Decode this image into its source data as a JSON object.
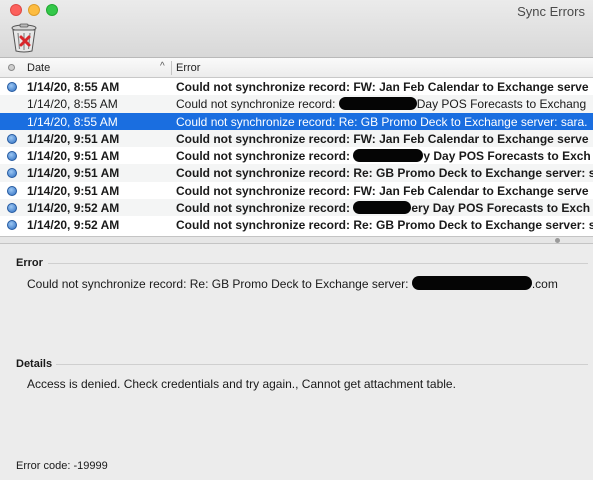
{
  "window": {
    "title": "Sync Errors"
  },
  "toolbar": {
    "trash_icon": "trash-icon"
  },
  "table": {
    "columns": {
      "date": "Date",
      "error": "Error"
    },
    "rows": [
      {
        "date": "1/14/20, 8:55 AM",
        "error": "Could not synchronize record: FW: Jan Feb Calendar  to Exchange serve",
        "bold": true,
        "selected": false,
        "dot": true
      },
      {
        "date": "1/14/20, 8:55 AM",
        "error_pre": "Could not synchronize record: ",
        "error_post": "Day POS Forecasts to Exchang",
        "bold": false,
        "selected": false,
        "dot": false
      },
      {
        "date": "1/14/20, 8:55 AM",
        "error": "Could not synchronize record: Re: GB Promo Deck to Exchange server: sara.",
        "bold": false,
        "selected": true,
        "dot": false
      },
      {
        "date": "1/14/20, 9:51 AM",
        "error": "Could not synchronize record: FW: Jan Feb Calendar  to Exchange serve",
        "bold": true,
        "selected": false,
        "dot": true
      },
      {
        "date": "1/14/20, 9:51 AM",
        "error_pre": "Could not synchronize record: ",
        "error_post": "y Day POS Forecasts to Exch",
        "bold": true,
        "selected": false,
        "dot": true
      },
      {
        "date": "1/14/20, 9:51 AM",
        "error": "Could not synchronize record: Re: GB Promo Deck to Exchange server: s",
        "bold": true,
        "selected": false,
        "dot": true
      },
      {
        "date": "1/14/20, 9:51 AM",
        "error": "Could not synchronize record: FW: Jan Feb Calendar  to Exchange serve",
        "bold": true,
        "selected": false,
        "dot": true
      },
      {
        "date": "1/14/20, 9:52 AM",
        "error_pre": "Could not synchronize record: ",
        "error_post": "ery Day POS Forecasts to Exch",
        "bold": true,
        "selected": false,
        "dot": true
      },
      {
        "date": "1/14/20, 9:52 AM",
        "error": "Could not synchronize record: Re: GB Promo Deck to Exchange server: s",
        "bold": true,
        "selected": false,
        "dot": true
      }
    ]
  },
  "detail": {
    "error_heading": "Error",
    "error_text_pre": "Could not synchronize record: Re: GB Promo Deck to Exchange server: ",
    "error_text_post": ".com",
    "details_heading": "Details",
    "details_text": "Access is denied. Check credentials and try again., Cannot get attachment table.",
    "error_code": "Error code: -19999"
  }
}
